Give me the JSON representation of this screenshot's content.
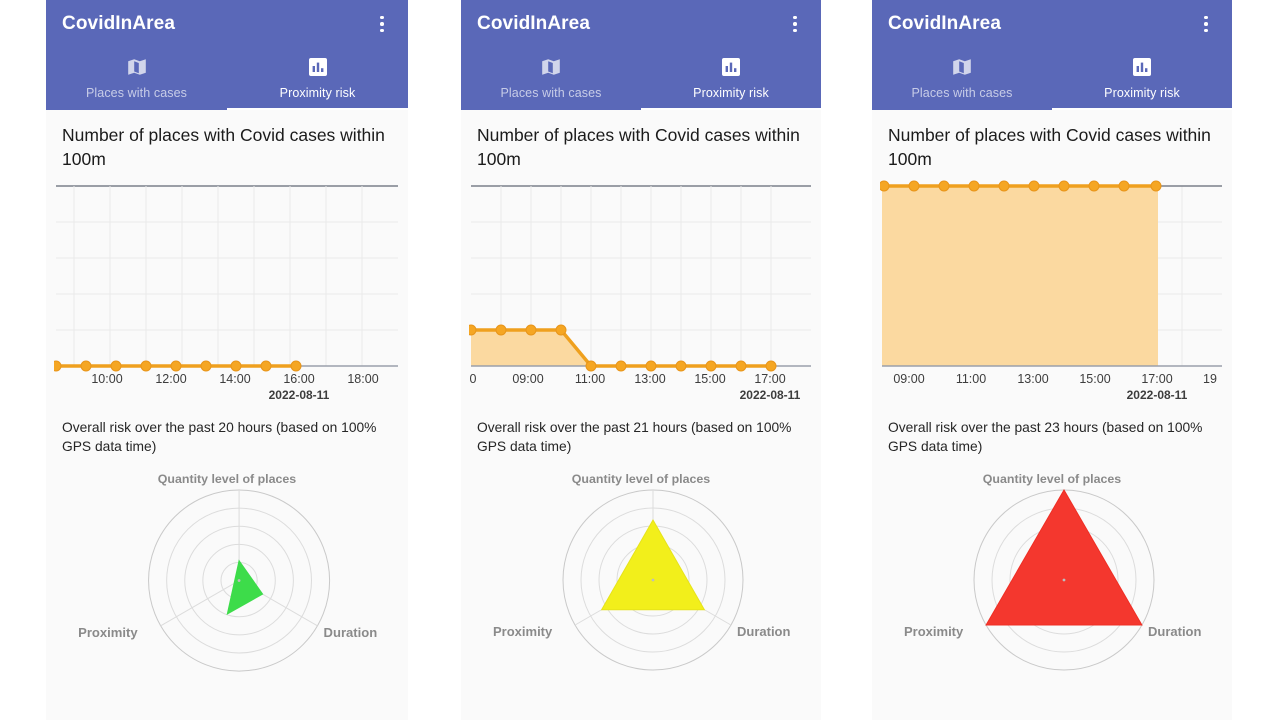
{
  "theme": {
    "appbar_color": "#5a68b8",
    "panel_bg": "#fafafa",
    "page_bg": "#ffffff",
    "line_color": "#f5a623",
    "line_color_stroke": "#efa01e",
    "area_fill": "#fbd9a0",
    "grid_color": "#e8e8e8",
    "axis_color": "#7b7f8a"
  },
  "app": {
    "title": "CovidInArea",
    "overflow_icon": "more-vert-icon",
    "tabs": [
      {
        "label": "Places with cases",
        "icon": "map-icon",
        "active": false
      },
      {
        "label": "Proximity risk",
        "icon": "bar-chart-icon",
        "active": true
      }
    ]
  },
  "panels": [
    {
      "card_title": "Number of places with Covid cases within 100m",
      "risk_text": "Overall risk over the past 20 hours (based on 100% GPS data time)",
      "radar_title": "Quantity level of places",
      "radar_axes": [
        "Quantity level of places",
        "Proximity",
        "Duration"
      ],
      "radar_color": "#3ddc4a",
      "x_tick_labels": [
        "10:00",
        "12:00",
        "14:00",
        "16:00",
        "18:00"
      ],
      "x_date_label": "2022-08-11",
      "x_date_under_tick": "16:00"
    },
    {
      "card_title": "Number of places with Covid cases within 100m",
      "risk_text": "Overall risk over the past 21 hours (based on 100% GPS data time)",
      "radar_title": "Quantity level of places",
      "radar_axes": [
        "Quantity level of places",
        "Proximity",
        "Duration"
      ],
      "radar_color": "#f2ef1b",
      "x_tick_labels": [
        "0",
        "09:00",
        "11:00",
        "13:00",
        "15:00",
        "17:00"
      ],
      "x_date_label": "2022-08-11",
      "x_date_under_tick": "17:00"
    },
    {
      "card_title": "Number of places with Covid cases within 100m",
      "risk_text": "Overall risk over the past 23 hours (based on 100% GPS data time)",
      "radar_title": "Quantity level of places",
      "radar_axes": [
        "Quantity level of places",
        "Proximity",
        "Duration"
      ],
      "radar_color": "#f4372e",
      "x_tick_labels": [
        "09:00",
        "11:00",
        "13:00",
        "15:00",
        "17:00",
        "19"
      ],
      "x_date_label": "2022-08-11",
      "x_date_under_tick": "17:00"
    }
  ],
  "chart_data": [
    {
      "type": "area",
      "title": "Number of places with Covid cases within 100m",
      "xlabel": "2022-08-11",
      "ylabel": "",
      "x": [
        "09:00",
        "10:00",
        "11:00",
        "12:00",
        "13:00",
        "14:00",
        "15:00",
        "16:00",
        "16:30"
      ],
      "values": [
        0,
        0,
        0,
        0,
        0,
        0,
        0,
        0,
        0
      ],
      "tick_labels": [
        "10:00",
        "12:00",
        "14:00",
        "16:00",
        "18:00"
      ],
      "ylim": [
        0,
        5
      ],
      "grid": true,
      "legend": "none",
      "marker_count": 9
    },
    {
      "type": "area",
      "title": "Number of places with Covid cases within 100m",
      "xlabel": "2022-08-11",
      "ylabel": "",
      "x": [
        "08:00",
        "08:30",
        "09:30",
        "10:30",
        "11:00",
        "12:00",
        "13:00",
        "14:00",
        "15:00",
        "16:00",
        "17:00"
      ],
      "values": [
        1,
        1,
        1,
        1,
        0,
        0,
        0,
        0,
        0,
        0,
        0
      ],
      "tick_labels": [
        "0",
        "09:00",
        "11:00",
        "13:00",
        "15:00",
        "17:00"
      ],
      "ylim": [
        0,
        5
      ],
      "grid": true,
      "legend": "none",
      "marker_count": 11
    },
    {
      "type": "area",
      "title": "Number of places with Covid cases within 100m",
      "xlabel": "2022-08-11",
      "ylabel": "",
      "x": [
        "08:30",
        "09:30",
        "10:30",
        "11:30",
        "12:30",
        "13:30",
        "14:30",
        "15:30",
        "16:30",
        "17:30"
      ],
      "values": [
        5,
        5,
        5,
        5,
        5,
        5,
        5,
        5,
        5,
        5
      ],
      "tick_labels": [
        "09:00",
        "11:00",
        "13:00",
        "15:00",
        "17:00",
        "19"
      ],
      "ylim": [
        0,
        5
      ],
      "grid": true,
      "legend": "none",
      "marker_count": 10
    },
    {
      "type": "radar",
      "title": "Quantity level of places",
      "categories": [
        "Quantity level of places",
        "Proximity",
        "Duration"
      ],
      "series": [
        {
          "name": "risk-low",
          "values": [
            0.22,
            0.13,
            0.3
          ],
          "color": "#3ddc4a"
        },
        {
          "name": "risk-medium",
          "values": [
            0.62,
            0.55,
            0.66
          ],
          "color": "#f2ef1b"
        },
        {
          "name": "risk-high",
          "values": [
            1.0,
            1.0,
            1.0
          ],
          "color": "#f4372e"
        }
      ],
      "rings": 5,
      "rmax": 1.0,
      "grid": true,
      "legend": "none"
    }
  ]
}
